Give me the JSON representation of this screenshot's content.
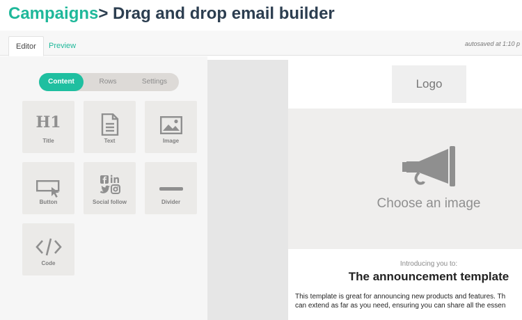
{
  "header": {
    "crumb": "Campaigns",
    "title": "> Drag and drop email builder"
  },
  "tabs": {
    "editor": "Editor",
    "preview": "Preview",
    "autosave": "autosaved at 1:10 p"
  },
  "panel": {
    "segments": {
      "content": "Content",
      "rows": "Rows",
      "settings": "Settings",
      "active": "Content"
    },
    "blocks": [
      {
        "label": "Title",
        "icon": "heading-h1-icon",
        "glyph": "H1"
      },
      {
        "label": "Text",
        "icon": "document-icon"
      },
      {
        "label": "Image",
        "icon": "image-icon"
      },
      {
        "label": "Button",
        "icon": "button-cursor-icon"
      },
      {
        "label": "Social follow",
        "icon": "social-icons"
      },
      {
        "label": "Divider",
        "icon": "divider-icon"
      },
      {
        "label": "Code",
        "icon": "code-icon"
      }
    ]
  },
  "email": {
    "logo": "Logo",
    "image_placeholder": "Choose an image",
    "image_icon": "megaphone-icon",
    "intro": "Introducing you to:",
    "heading": "The announcement template",
    "body_lines": [
      "This template is great for announcing new products and features. Th",
      "can extend as far as you need, ensuring you can share all the essen"
    ]
  },
  "colors": {
    "accent": "#1fb89a",
    "title": "#2c3e50",
    "tile": "#ebeae8",
    "icon": "#8f8f8f"
  }
}
